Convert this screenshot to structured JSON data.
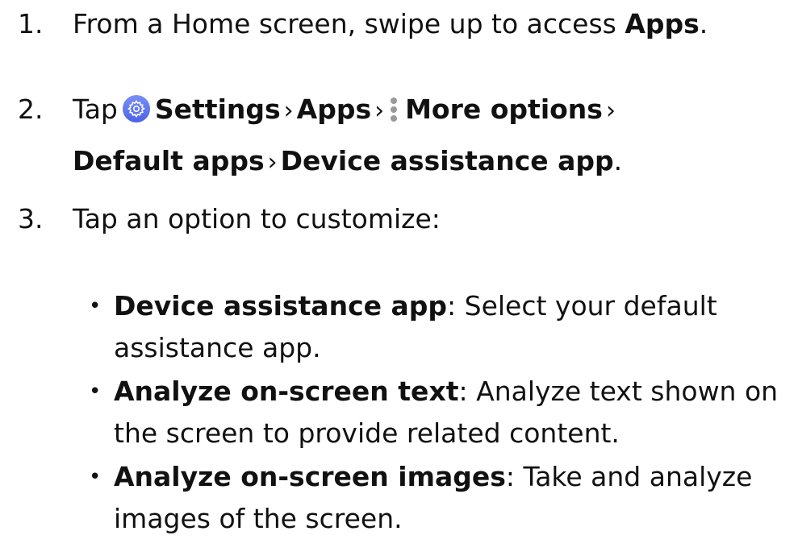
{
  "steps": [
    {
      "number": "1.",
      "parts": [
        {
          "text": "From a Home screen, swipe up to access ",
          "bold": false
        },
        {
          "text": "Apps",
          "bold": true
        },
        {
          "text": ".",
          "bold": false
        }
      ]
    },
    {
      "number": "2.",
      "line1": {
        "tap": "Tap",
        "settings": "Settings",
        "apps": "Apps",
        "more_options": "More options"
      },
      "line2": {
        "default_apps": "Default apps",
        "device_assistance_app": "Device assistance app",
        "period": "."
      },
      "separator": "›",
      "icons": [
        "settings-gear-icon",
        "more-options-vertical-dots-icon"
      ]
    },
    {
      "number": "3.",
      "text": "Tap an option to customize:"
    }
  ],
  "bullets": [
    {
      "title": "Device assistance app",
      "line1": ": Select your default",
      "line2": "assistance app."
    },
    {
      "title": "Analyze on-screen text",
      "line1": ": Analyze text shown on",
      "line2": "the screen to provide related content."
    },
    {
      "title": "Analyze on-screen images",
      "line1": ": Take and analyze",
      "line2": "images of the screen."
    }
  ],
  "bullet_glyph": "•",
  "colors": {
    "text": "#111111",
    "settings_icon": "#5b70ee",
    "dots": "#9a9a9a"
  }
}
